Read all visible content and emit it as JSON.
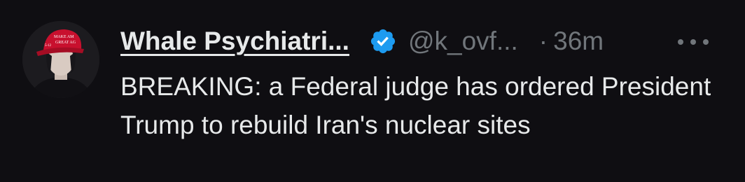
{
  "tweet": {
    "author": {
      "display_name": "Whale Psychiatri...",
      "handle": "@k_ovf...",
      "verified_icon": "verified-badge-icon",
      "verified_color": "#1d9bf0",
      "avatar_hat_text_line1": "MAKE AM",
      "avatar_hat_text_line2": "GREAT AG",
      "avatar_hat_side_text": "5-12",
      "avatar_hat_color": "#c8102e"
    },
    "separator": "·",
    "timestamp": "36m",
    "more_icon": "more-options-icon",
    "text": "BREAKING: a Federal judge has ordered President Trump to rebuild Iran's nuclear sites"
  },
  "colors": {
    "background": "#0f0e12",
    "primary_text": "#e7e9ea",
    "secondary_text": "#71767b"
  }
}
